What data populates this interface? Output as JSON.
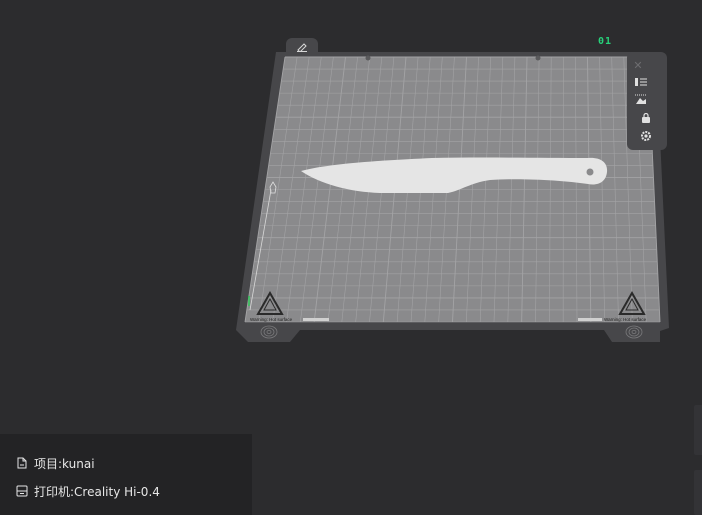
{
  "plate": {
    "index_label": "01",
    "warning_left": "Warning: Hot surface",
    "warning_right": "Warning: Hot surface"
  },
  "model": {
    "name": "kunai"
  },
  "info": {
    "project_label": "项目:kunai",
    "printer_label": "打印机:Creality Hi-0.4"
  },
  "icons": {
    "edit": "pencil-icon",
    "close": "close-icon",
    "tool1": "arrange-list-icon",
    "tool2": "auto-orient-icon",
    "tool3": "lock-icon",
    "tool4": "settings-gear-icon",
    "project": "file-icon",
    "printer": "printer-icon"
  },
  "colors": {
    "background": "#2c2c2e",
    "bed_surface": "#8a8a8c",
    "bed_frame": "#47474a",
    "grid_line": "#a3a3a5",
    "model": "#e5e5e5",
    "plate_label": "#27d17a"
  }
}
